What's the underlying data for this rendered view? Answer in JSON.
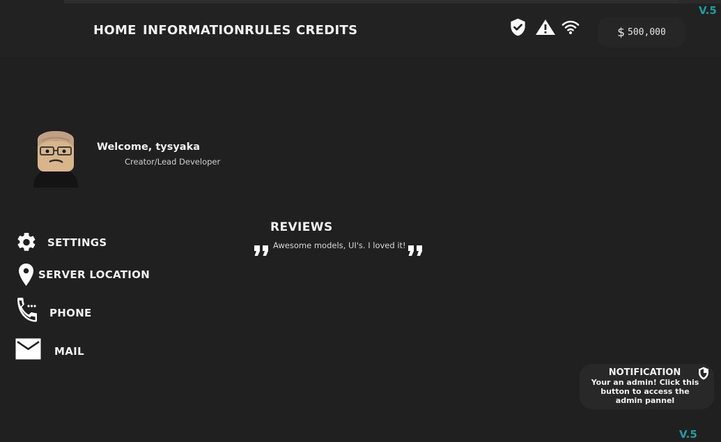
{
  "nav": {
    "home": "HOME",
    "information": "INFORMATION",
    "rules": "RULES",
    "credits": "CREDITS"
  },
  "status_icons": [
    "shield-check-icon",
    "warning-icon",
    "wifi-icon"
  ],
  "money": {
    "symbol": "$",
    "amount": "500,000"
  },
  "version": {
    "top": "V.5",
    "bottom": "V.5"
  },
  "profile": {
    "welcome": "Welcome, tysyaka",
    "role": "Creator/Lead Developer"
  },
  "menu": {
    "settings": "SETTINGS",
    "server_location": "SERVER LOCATION",
    "phone": "PHONE",
    "mail": "MAIL"
  },
  "reviews": {
    "title": "REVIEWS",
    "text": "Awesome models, UI's. I loved it!"
  },
  "notification": {
    "title": "NOTIFICATION",
    "body": "Your an admin! Click this button to access the admin pannel"
  },
  "colors": {
    "background": "#202020",
    "topbar": "#222222",
    "accent_version": "#1c9fa3"
  }
}
